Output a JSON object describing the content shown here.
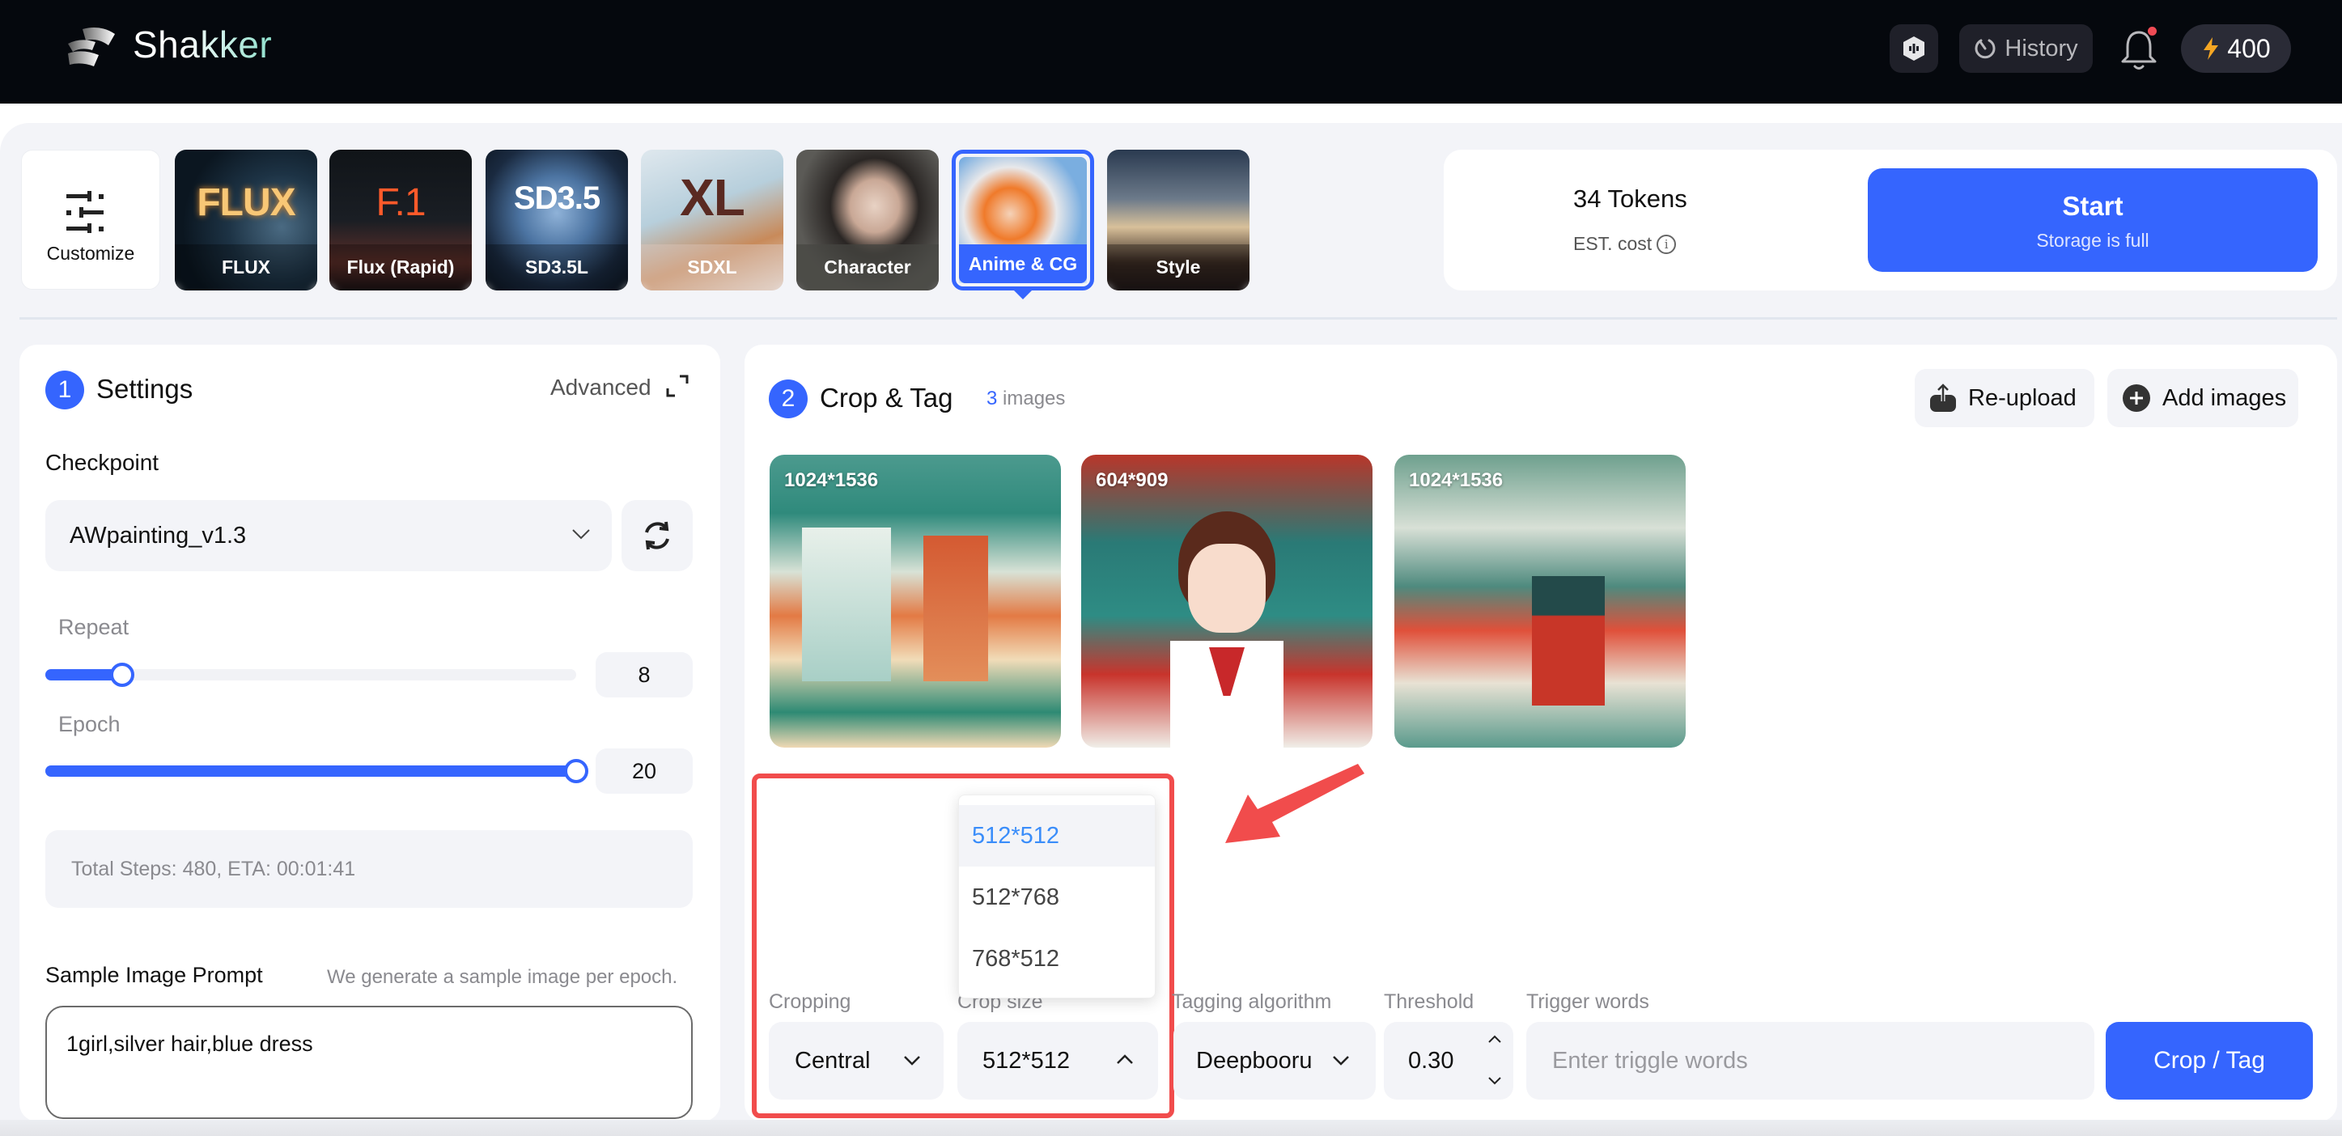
{
  "header": {
    "brand": "Shakker",
    "history_label": "History",
    "credits": "400",
    "icons": {
      "logo": "shakker-logo-icon",
      "hex": "discord-hex-icon",
      "history": "history-clock-icon",
      "bell": "bell-icon",
      "bolt": "lightning-bolt-icon"
    },
    "notification_dot": true
  },
  "models": {
    "customize_label": "Customize",
    "cards": [
      {
        "label": "FLUX",
        "thumb_text": "FLUX",
        "selected": false
      },
      {
        "label": "Flux (Rapid)",
        "thumb_text": "F.1",
        "selected": false
      },
      {
        "label": "SD3.5L",
        "thumb_text": "SD3.5",
        "selected": false
      },
      {
        "label": "SDXL",
        "thumb_text": "XL",
        "selected": false
      },
      {
        "label": "Character",
        "thumb_text": "",
        "selected": false
      },
      {
        "label": "Anime & CG",
        "thumb_text": "",
        "selected": true
      },
      {
        "label": "Style",
        "thumb_text": "",
        "selected": false
      }
    ]
  },
  "cost": {
    "tokens": "34 Tokens",
    "est_label": "EST. cost",
    "info_icon": "i"
  },
  "start": {
    "label": "Start",
    "sublabel": "Storage is full"
  },
  "settings": {
    "step": "1",
    "title": "Settings",
    "advanced_label": "Advanced",
    "checkpoint_label": "Checkpoint",
    "checkpoint_value": "AWpainting_v1.3",
    "repeat_label": "Repeat",
    "repeat_value": "8",
    "repeat_fraction": 0.145,
    "epoch_label": "Epoch",
    "epoch_value": "20",
    "epoch_fraction": 1.0,
    "steps_text": "Total Steps: 480,  ETA: 00:01:41",
    "sample_label": "Sample Image Prompt",
    "sample_hint": "We generate a sample image per epoch.",
    "sample_prompt": "1girl,silver hair,blue dress"
  },
  "crop_tag": {
    "step": "2",
    "title": "Crop & Tag",
    "image_count": "3",
    "image_count_suffix": " images",
    "reupload_label": "Re-upload",
    "add_images_label": "Add images",
    "images": [
      {
        "dimensions": "1024*1536"
      },
      {
        "dimensions": "604*909"
      },
      {
        "dimensions": "1024*1536"
      }
    ],
    "cropping_label": "Cropping",
    "cropping_value": "Central",
    "crop_size_label": "Crop size",
    "crop_size_value": "512*512",
    "crop_size_options": [
      "512*512",
      "512*768",
      "768*512"
    ],
    "crop_size_selected": "512*512",
    "tagging_label": "Tagging algorithm",
    "tagging_value": "Deepbooru",
    "threshold_label": "Threshold",
    "threshold_value": "0.30",
    "trigger_label": "Trigger words",
    "trigger_placeholder": "Enter triggle words",
    "trigger_value": "",
    "crop_tag_button": "Crop / Tag"
  },
  "annotation": {
    "color": "#f14c4c",
    "target": "crop-size-dropdown"
  },
  "colors": {
    "accent": "#3565fe",
    "header_bg": "#05080d",
    "panel_bg": "#f3f4f8",
    "annotation": "#f14c4c",
    "dropdown_active": "#3a8dfa"
  }
}
